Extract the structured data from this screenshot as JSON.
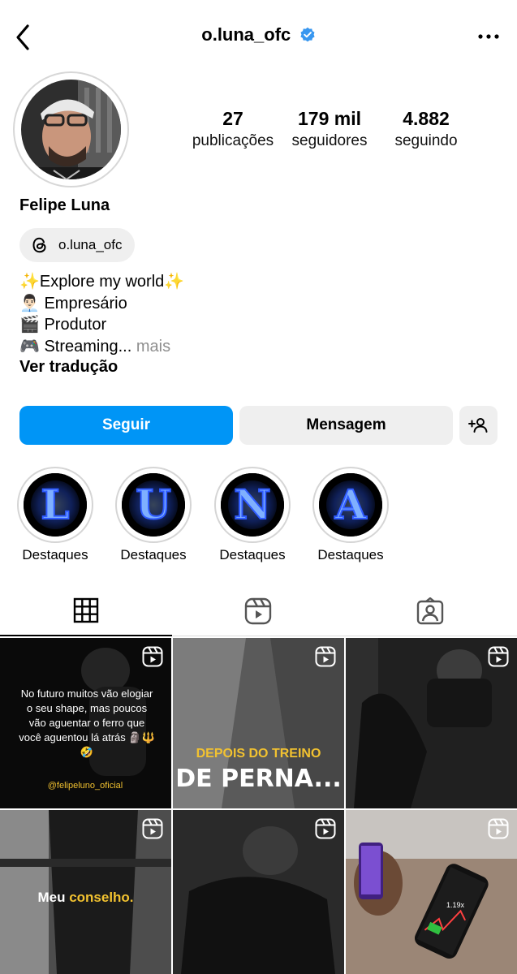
{
  "header": {
    "username": "o.luna_ofc",
    "verified": true,
    "back_icon": "chevron-left-icon",
    "more_icon": "more-dots-icon"
  },
  "profile": {
    "full_name": "Felipe Luna",
    "threads_handle": "o.luna_ofc",
    "stats": {
      "posts_count": "27",
      "posts_label": "publicações",
      "followers_count": "179 mil",
      "followers_label": "seguidores",
      "following_count": "4.882",
      "following_label": "seguindo"
    },
    "bio": {
      "line1": "✨Explore my world✨",
      "line2_emoji": "👨🏻‍💼",
      "line2_text": "Empresário",
      "line3_emoji": "🎬",
      "line3_text": "Produtor",
      "line4_emoji": "🎮",
      "line4_text": "Streaming...",
      "more": "mais"
    },
    "translate_label": "Ver tradução"
  },
  "actions": {
    "follow_label": "Seguir",
    "message_label": "Mensagem",
    "add_user_icon": "add-user-icon"
  },
  "highlights": [
    {
      "letter": "L",
      "label": "Destaques"
    },
    {
      "letter": "U",
      "label": "Destaques"
    },
    {
      "letter": "N",
      "label": "Destaques"
    },
    {
      "letter": "A",
      "label": "Destaques"
    }
  ],
  "tabs": [
    {
      "icon": "grid-icon",
      "active": true
    },
    {
      "icon": "reels-icon",
      "active": false
    },
    {
      "icon": "tagged-icon",
      "active": false
    }
  ],
  "posts": [
    {
      "text": "No futuro muitos vão elogiar o seu shape, mas poucos vão aguentar o ferro que você aguentou lá atrás 🗿🔱🤣",
      "caption": "@felipeluno_oficial",
      "reel": true
    },
    {
      "line1": "DEPOIS DO TREINO",
      "line2": "DE PERNA...",
      "reel": true
    },
    {
      "reel": true
    },
    {
      "text_plain": "Meu ",
      "text_accent": "conselho.",
      "reel": true
    },
    {
      "reel": true
    },
    {
      "overlay": "1.19x",
      "reel": true
    }
  ],
  "colors": {
    "accent": "#0095f6",
    "verified": "#3897f0",
    "button_bg": "#efefef",
    "muted": "#8e8e8e",
    "highlight_flame": "#3b6cff",
    "yellow_caption": "#f2c230"
  }
}
